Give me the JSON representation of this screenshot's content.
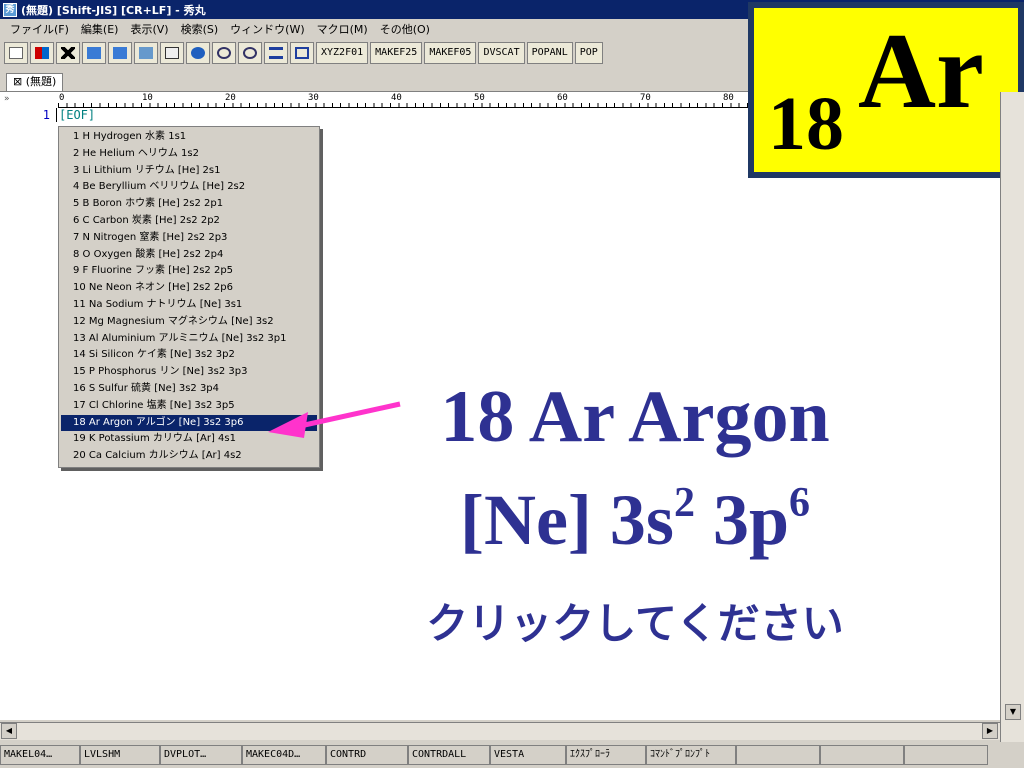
{
  "window": {
    "title": "(無題) [Shift-JIS] [CR+LF] - 秀丸",
    "app_icon_glyph": "秀"
  },
  "menu": [
    "ファイル(F)",
    "編集(E)",
    "表示(V)",
    "検索(S)",
    "ウィンドウ(W)",
    "マクロ(M)",
    "その他(O)"
  ],
  "toolbar": {
    "macro_buttons": [
      "XYZ2F01",
      "MAKEF25",
      "MAKEF05",
      "DVSCAT",
      "POPANL",
      "POP"
    ]
  },
  "tab": {
    "label": "(無題)"
  },
  "editor": {
    "gutter_mark": "»",
    "ruler_labels": [
      "0",
      "10",
      "20",
      "30",
      "40",
      "50",
      "60",
      "70",
      "80"
    ],
    "line_number": "1",
    "eof_text": "[EOF]"
  },
  "popup": {
    "items": [
      "1 H Hydrogen 水素 1s1",
      "2 He Helium ヘリウム 1s2",
      "3 Li Lithium リチウム [He] 2s1",
      "4 Be Beryllium ベリリウム [He] 2s2",
      "5 B Boron ホウ素 [He] 2s2 2p1",
      "6 C Carbon 炭素 [He] 2s2 2p2",
      "7 N Nitrogen 窒素 [He] 2s2 2p3",
      "8 O Oxygen 酸素 [He] 2s2 2p4",
      "9 F Fluorine フッ素 [He] 2s2 2p5",
      "10 Ne Neon ネオン [He] 2s2 2p6",
      "11 Na Sodium ナトリウム [Ne] 3s1",
      "12 Mg Magnesium マグネシウム [Ne] 3s2",
      "13 Al Aluminium アルミニウム [Ne] 3s2 3p1",
      "14 Si Silicon ケイ素 [Ne] 3s2 3p2",
      "15 P Phosphorus リン [Ne] 3s2 3p3",
      "16 S Sulfur 硫黄 [Ne] 3s2 3p4",
      "17 Cl Chlorine 塩素 [Ne] 3s2 3p5",
      "18 Ar Argon アルゴン [Ne] 3s2 3p6",
      "19 K Potassium カリウム [Ar] 4s1",
      "20 Ca Calcium カルシウム [Ar] 4s2"
    ],
    "selected_index": 17
  },
  "badge": {
    "number": "18",
    "symbol": "Ar"
  },
  "overlay": {
    "title": "18 Ar Argon",
    "config_core": "[Ne] 3s",
    "config_exp1": "2",
    "config_mid": " 3p",
    "config_exp2": "6",
    "click_text": "クリックしてください"
  },
  "status": [
    "MAKEL04…",
    "LVLSHM",
    "DVPLOT…",
    "MAKEC04D…",
    "CONTRD",
    "CONTRDALL",
    "VESTA",
    "ｴｸｽﾌﾟﾛｰﾗ",
    "ｺﾏﾝﾄﾞﾌﾟﾛﾝﾌﾟﾄ"
  ],
  "colors": {
    "titlebar": "#0a246a",
    "accent_text": "#2e3192",
    "badge_bg": "#ffff00",
    "badge_border": "#1f3864",
    "arrow": "#ff33cc",
    "selection": "#0a246a"
  }
}
